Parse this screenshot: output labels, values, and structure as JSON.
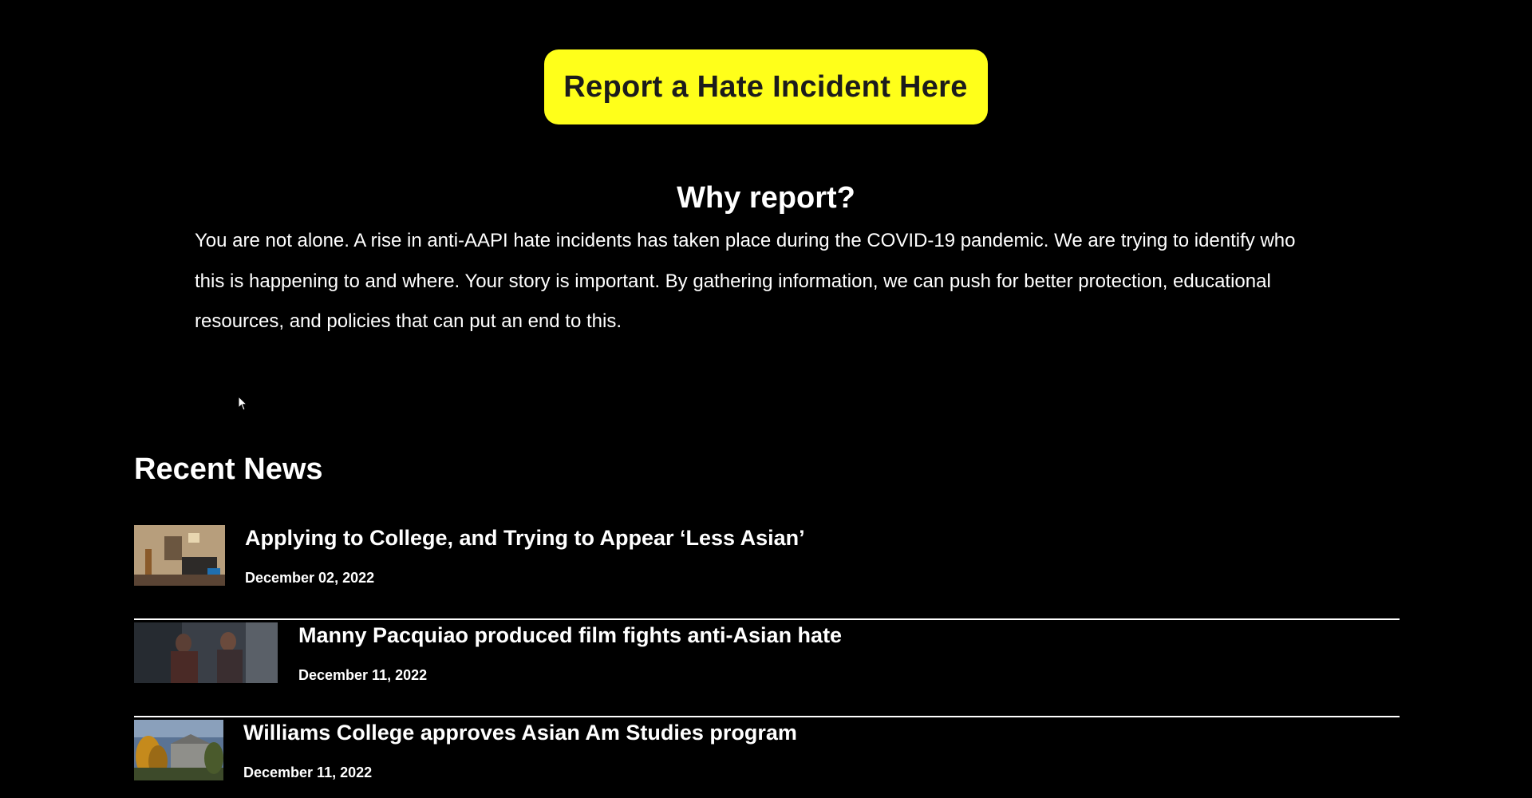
{
  "report": {
    "button_label": "Report a Hate Incident Here",
    "button_color": "#ffff1a"
  },
  "why": {
    "title": "Why report?",
    "body": "You are not alone. A rise in anti-AAPI hate incidents has taken place during the COVID-19 pandemic. We are trying to identify who this is happening to and where. Your story is important. By gathering information, we can push for better protection, educational resources, and policies that can put an end to this."
  },
  "news": {
    "title": "Recent News",
    "items": [
      {
        "headline": "Applying to College, and Trying to Appear ‘Less Asian’",
        "date": "December 02, 2022",
        "thumb_icon": "dorm-room-photo"
      },
      {
        "headline": "Manny Pacquiao produced film fights anti-Asian hate",
        "date": "December 11, 2022",
        "thumb_icon": "film-still-photo"
      },
      {
        "headline": "Williams College approves Asian Am Studies program",
        "date": "December 11, 2022",
        "thumb_icon": "campus-photo"
      }
    ]
  },
  "colors": {
    "background": "#000000",
    "text": "#ffffff",
    "accent": "#ffff1a"
  }
}
